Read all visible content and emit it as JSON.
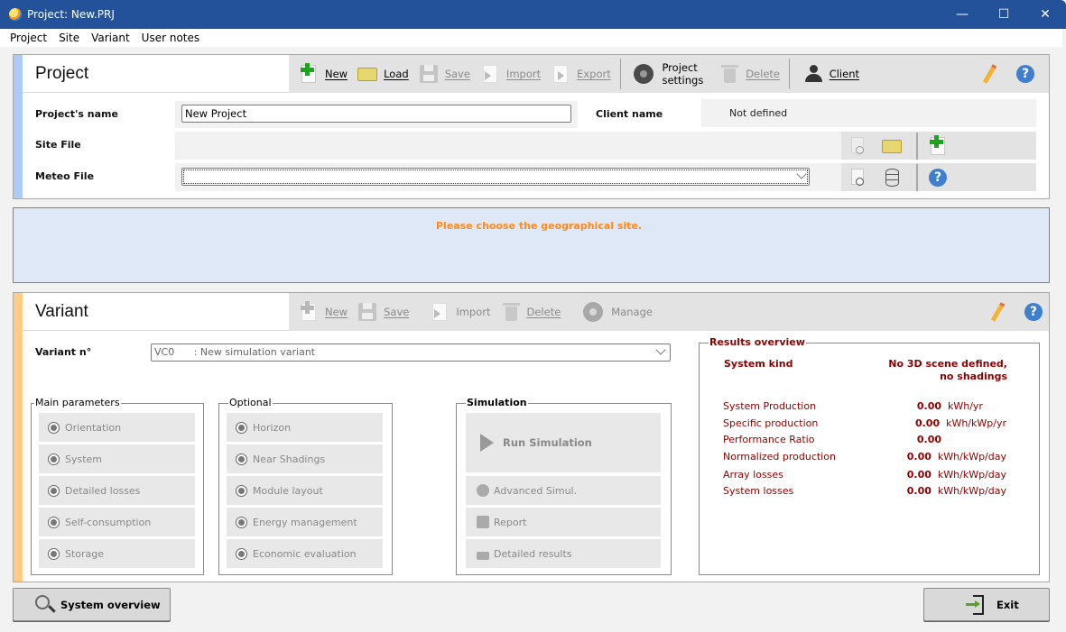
{
  "window": {
    "title": "Project:  New.PRJ",
    "controls": {
      "minimize": "—",
      "maximize": "☐",
      "close": "✕"
    }
  },
  "menu": [
    "Project",
    "Site",
    "Variant",
    "User notes"
  ],
  "project": {
    "title": "Project",
    "toolbar": {
      "new": "New",
      "load": "Load",
      "save": "Save",
      "import": "Import",
      "export": "Export",
      "settings": "Project settings",
      "delete": "Delete",
      "client": "Client"
    },
    "labels": {
      "name": "Project's name",
      "client": "Client name",
      "site": "Site File",
      "meteo": "Meteo File"
    },
    "values": {
      "name": "New Project",
      "client": "Not defined",
      "site": "",
      "meteo": ""
    }
  },
  "message": {
    "text": "Please choose the geographical site.",
    "color": "#ff8a1a"
  },
  "variant": {
    "title": "Variant",
    "toolbar": {
      "new": "New",
      "save": "Save",
      "import": "Import",
      "delete": "Delete",
      "manage": "Manage"
    },
    "number_label": "Variant n°",
    "selected": {
      "code": "VC0",
      "description": ": New simulation variant"
    },
    "main_parameters": {
      "legend": "Main parameters",
      "items": [
        "Orientation",
        "System",
        "Detailed losses",
        "Self-consumption",
        "Storage"
      ]
    },
    "optional": {
      "legend": "Optional",
      "items": [
        "Horizon",
        "Near Shadings",
        "Module layout",
        "Energy management",
        "Economic evaluation"
      ]
    },
    "simulation": {
      "legend": "Simulation",
      "run": "Run Simulation",
      "advanced": "Advanced Simul.",
      "report": "Report",
      "detailed": "Detailed results"
    },
    "results": {
      "legend": "Results overview",
      "system_kind_label": "System kind",
      "system_kind_value": "No 3D scene defined, no shadings",
      "rows": [
        {
          "label": "System Production",
          "value": "0.00",
          "unit": "kWh/yr"
        },
        {
          "label": "Specific production",
          "value": "0.00",
          "unit": "kWh/kWp/yr"
        },
        {
          "label": "Performance Ratio",
          "value": "0.00",
          "unit": ""
        },
        {
          "label": "Normalized production",
          "value": "0.00",
          "unit": "kWh/kWp/day"
        },
        {
          "label": "Array losses",
          "value": "0.00",
          "unit": "kWh/kWp/day"
        },
        {
          "label": "System losses",
          "value": "0.00",
          "unit": "kWh/kWp/day"
        }
      ],
      "color": "#8b0000"
    }
  },
  "footer": {
    "system_overview": "System overview",
    "exit": "Exit"
  },
  "colors": {
    "titlebar": "#24529a",
    "project_accent": "#aecbf7",
    "variant_accent": "#ffcc88"
  }
}
